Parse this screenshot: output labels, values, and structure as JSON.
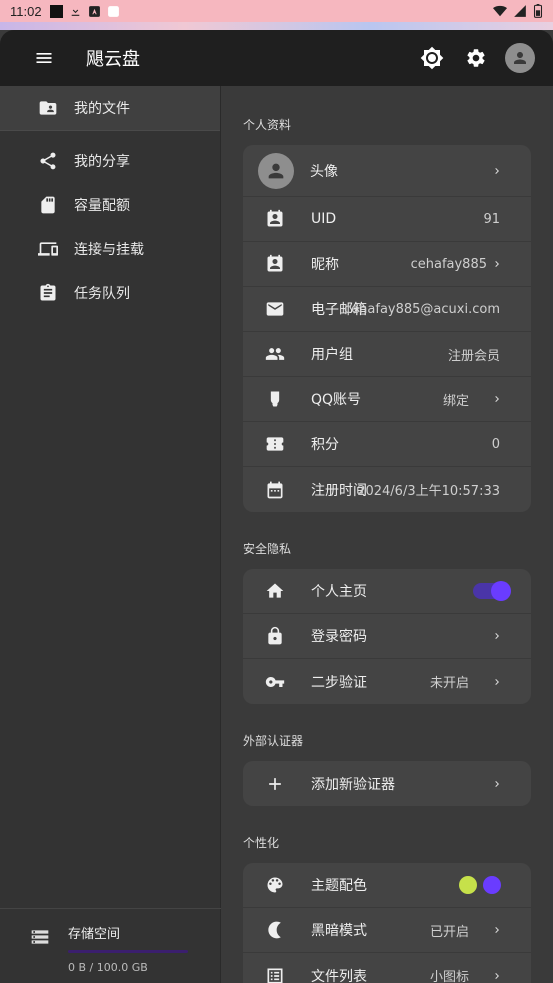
{
  "statusbar": {
    "time": "11:02"
  },
  "appbar": {
    "title": "飓云盘"
  },
  "sidebar": {
    "items": [
      {
        "label": "我的文件",
        "icon": "folder-account-icon"
      },
      {
        "label": "我的分享",
        "icon": "share-icon"
      },
      {
        "label": "容量配额",
        "icon": "sd-card-icon"
      },
      {
        "label": "连接与挂载",
        "icon": "devices-icon"
      },
      {
        "label": "任务队列",
        "icon": "clipboard-icon"
      }
    ],
    "storage": {
      "label": "存储空间",
      "usage": "0 B / 100.0 GB",
      "used_fraction": 0.0
    }
  },
  "profile": {
    "section_title": "个人资料",
    "avatar_label": "头像",
    "uid_label": "UID",
    "uid_value": "91",
    "nickname_label": "昵称",
    "nickname_value": "cehafay885",
    "email_label": "电子邮箱",
    "email_value": "cehafay885@acuxi.com",
    "group_label": "用户组",
    "group_value": "注册会员",
    "qq_label": "QQ账号",
    "qq_value": "绑定",
    "points_label": "积分",
    "points_value": "0",
    "register_label": "注册时间",
    "register_value": "2024/6/3上午10:57:33"
  },
  "privacy": {
    "section_title": "安全隐私",
    "homepage_label": "个人主页",
    "homepage_on": true,
    "password_label": "登录密码",
    "twofa_label": "二步验证",
    "twofa_value": "未开启"
  },
  "authenticator": {
    "section_title": "外部认证器",
    "add_label": "添加新验证器"
  },
  "personalize": {
    "section_title": "个性化",
    "theme_label": "主题配色",
    "theme_colors": [
      "#c6e14a",
      "#6a3cff"
    ],
    "dark_label": "黑暗模式",
    "dark_value": "已开启",
    "list_label": "文件列表",
    "list_value": "小图标"
  }
}
